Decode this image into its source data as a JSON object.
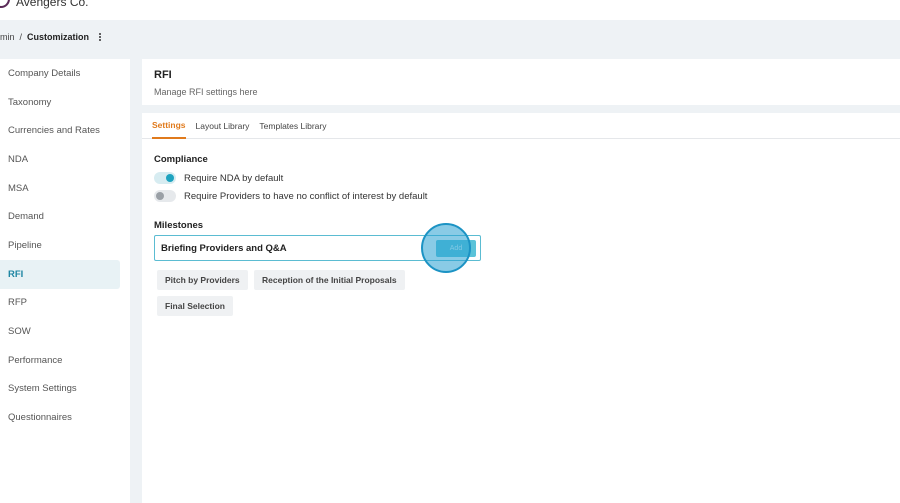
{
  "app": {
    "company_name": "Avengers Co."
  },
  "breadcrumb": {
    "parent": "min",
    "separator": "/",
    "current": "Customization",
    "menu_icon": "kebab-icon"
  },
  "sidebar": {
    "items": [
      {
        "label": "Company Details"
      },
      {
        "label": "Taxonomy"
      },
      {
        "label": "Currencies and Rates"
      },
      {
        "label": "NDA"
      },
      {
        "label": "MSA"
      },
      {
        "label": "Demand"
      },
      {
        "label": "Pipeline"
      },
      {
        "label": "RFI",
        "active": true
      },
      {
        "label": "RFP"
      },
      {
        "label": "SOW"
      },
      {
        "label": "Performance"
      },
      {
        "label": "System Settings"
      },
      {
        "label": "Questionnaires"
      }
    ]
  },
  "header": {
    "title": "RFI",
    "subtitle": "Manage RFI settings here"
  },
  "tabs": [
    {
      "label": "Settings",
      "active": true
    },
    {
      "label": "Layout Library"
    },
    {
      "label": "Templates Library"
    }
  ],
  "compliance": {
    "title": "Compliance",
    "options": [
      {
        "label": "Require NDA by default",
        "enabled": true
      },
      {
        "label": "Require Providers to have no conflict of interest by default",
        "enabled": false
      }
    ]
  },
  "milestones": {
    "title": "Milestones",
    "input_value": "Briefing Providers and Q&A",
    "add_label": "Add",
    "chips": [
      "Pitch by Providers",
      "Reception of the Initial Proposals",
      "Final Selection"
    ]
  },
  "colors": {
    "accent": "#1ea3bf",
    "tab_active": "#e07a1c",
    "brand": "#5a2a57"
  }
}
